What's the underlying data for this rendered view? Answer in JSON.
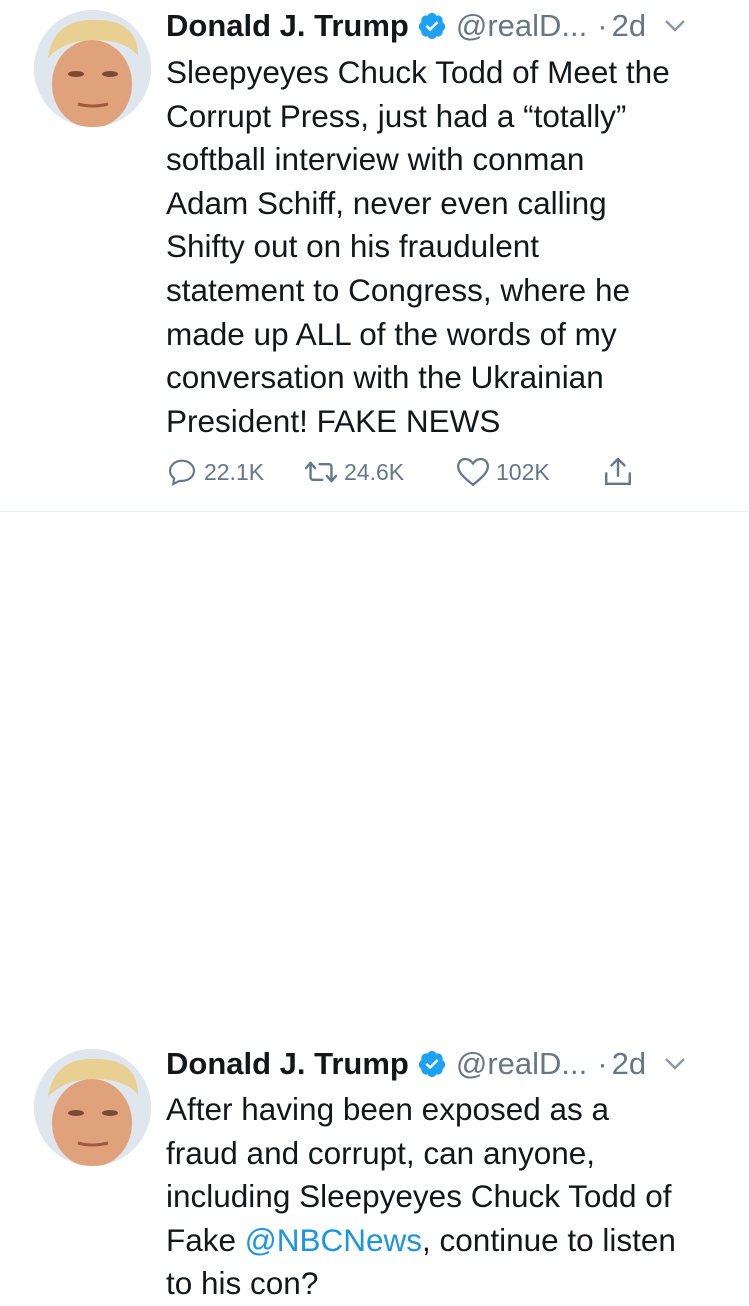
{
  "colors": {
    "text": "#14171a",
    "secondary": "#657786",
    "link": "#1b95e0",
    "verified": "#1da1f2",
    "divider": "#e6ecf0"
  },
  "tweets": [
    {
      "author": "Donald J. Trump",
      "handle": "@realD...",
      "dot": "·",
      "time": "2d",
      "lines": [
        "Sleepyeyes Chuck Todd of Meet the",
        "Corrupt Press, just had a “totally”",
        "softball interview with conman",
        "Adam Schiff, never even calling",
        "Shifty out on his fraudulent",
        "statement to Congress, where he",
        "made up ALL of the words of my",
        "conversation with the Ukrainian",
        "President! FAKE NEWS"
      ],
      "replies": "22.1K",
      "retweets": "24.6K",
      "likes": "102K",
      "icons": [
        "reply-icon",
        "retweet-icon",
        "like-icon",
        "share-icon"
      ]
    },
    {
      "author": "Donald J. Trump",
      "handle": "@realD...",
      "dot": "·",
      "time": "2d",
      "lines": [
        "After having been exposed as a",
        "fraud and corrupt, can anyone,",
        "including Sleepyeyes Chuck Todd of"
      ],
      "line4_prefix": "Fake ",
      "line4_mention": "@NBCNews",
      "line4_suffix": ", continue to listen",
      "line5": "to his con?"
    }
  ]
}
